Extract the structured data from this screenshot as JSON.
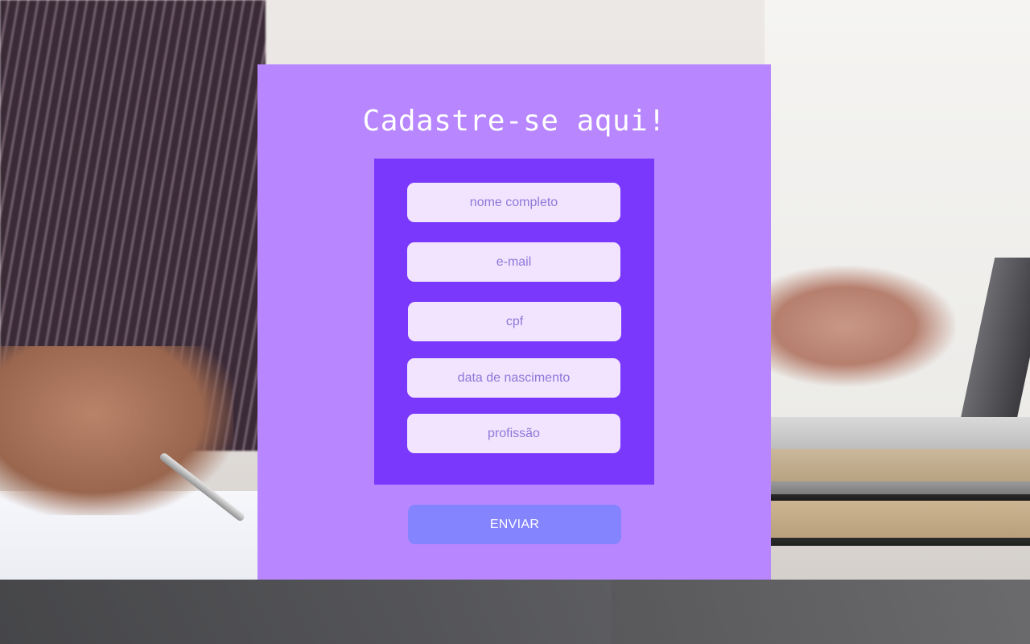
{
  "form": {
    "title": "Cadastre-se aqui!",
    "fields": [
      {
        "placeholder": "nome completo",
        "value": ""
      },
      {
        "placeholder": "e-mail",
        "value": ""
      },
      {
        "placeholder": "cpf",
        "value": ""
      },
      {
        "placeholder": "data de nascimento",
        "value": ""
      },
      {
        "placeholder": "profissão",
        "value": ""
      }
    ],
    "submit_label": "ENVIAR"
  },
  "colors": {
    "panel": "#b886fe",
    "inner_box": "#7a38fd",
    "field_bg": "#f2e4fe",
    "field_text": "#8e78d8",
    "button_bg": "#8384fe",
    "title_text": "#ffffff"
  }
}
